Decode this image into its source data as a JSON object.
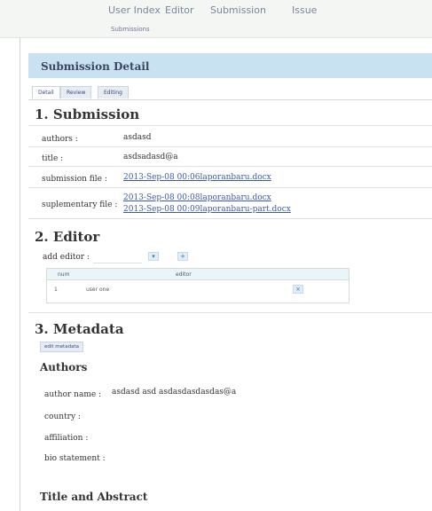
{
  "top_nav": {
    "items": [
      "User Index",
      "Editor",
      "Submission",
      "Issue"
    ]
  },
  "sub_nav": {
    "item": "Submissions"
  },
  "panel": {
    "title": "Submission Detail"
  },
  "tabs": [
    "Detail",
    "Review",
    "Editing"
  ],
  "submission": {
    "heading": "1. Submission",
    "authors_label": "authors :",
    "authors_value": "asdasd",
    "title_label": "title :",
    "title_value": "asdsadasd@a",
    "submission_file_label": "submission file :",
    "submission_file": "2013-Sep-08 00:06laporanbaru.docx",
    "supplementary_label": "suplementary file :",
    "supplementary_files": [
      "2013-Sep-08 00:08laporanbaru.docx",
      "2013-Sep-08 00:09laporanbaru-part.docx"
    ]
  },
  "editor": {
    "heading": "2. Editor",
    "add_label": "add editor :",
    "columns": [
      "num",
      "editor"
    ],
    "rows": [
      {
        "num": "1",
        "editor": "user one"
      }
    ]
  },
  "metadata": {
    "heading": "3. Metadata",
    "add_button": "edit metadata",
    "authors_heading": "Authors",
    "author_name_label": "author name :",
    "author_name_value": "asdasd asd asdasdasdasdas@a",
    "country_label": "country :",
    "affiliation_label": "affiliation :",
    "bio_label": "bio statement :",
    "title_abstract_heading": "Title and Abstract"
  },
  "icons": {
    "remove": "x-icon",
    "add": "plus-icon",
    "dropdown": "chevron-down-icon"
  }
}
